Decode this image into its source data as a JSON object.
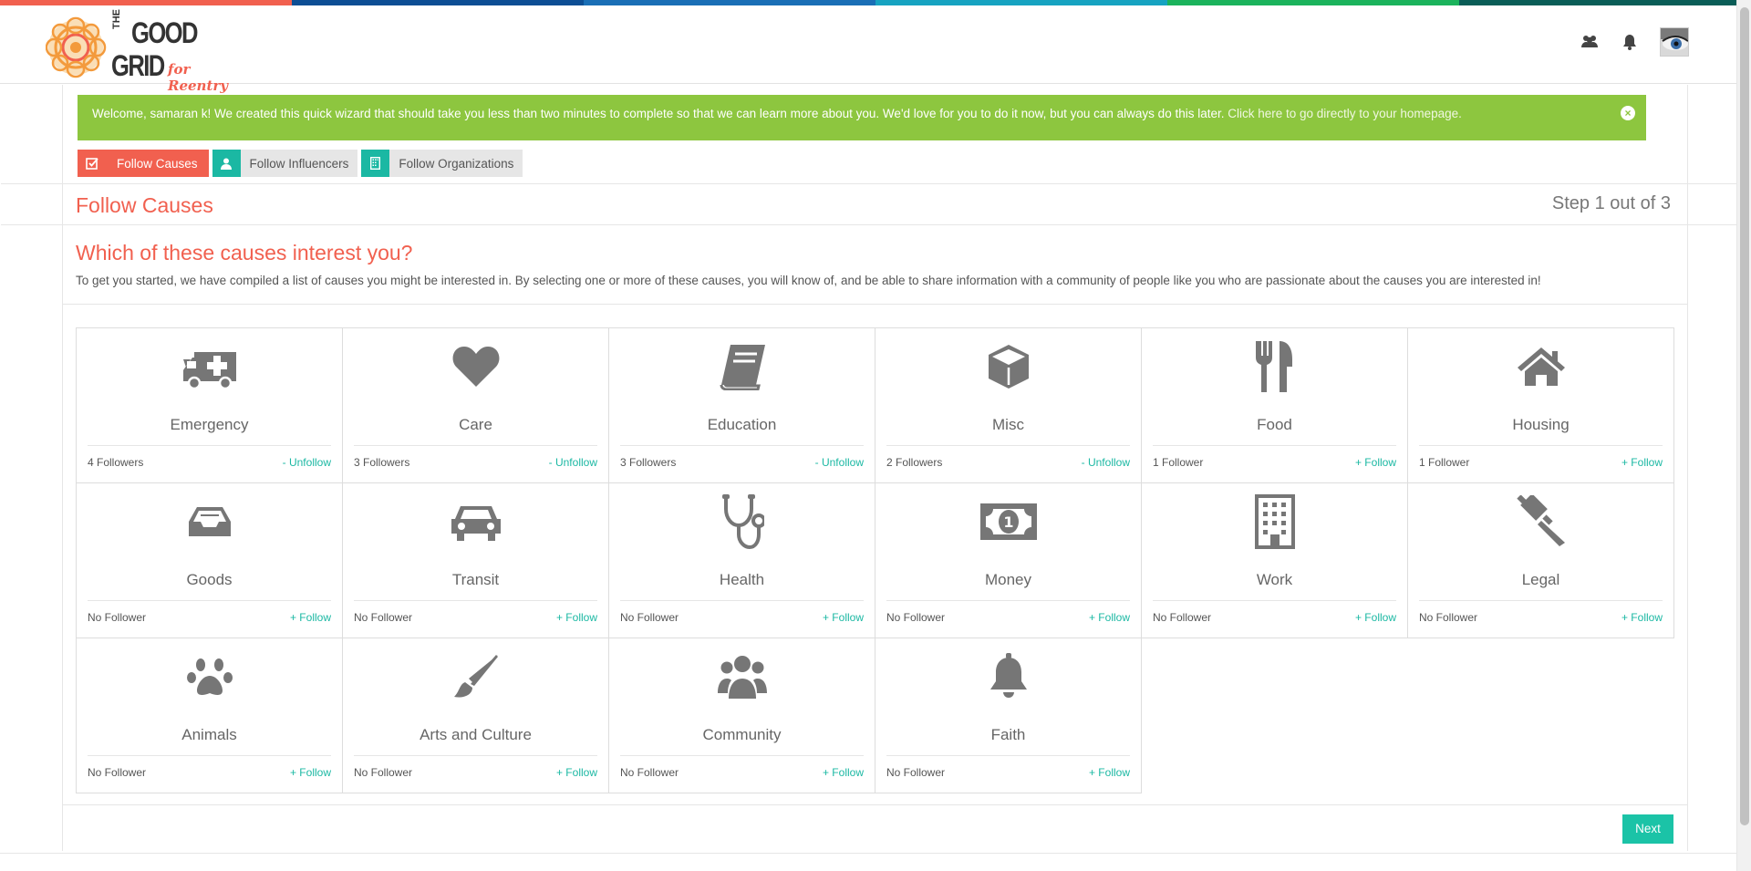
{
  "colors": {
    "top_strip": [
      "#f1604f",
      "#0d4e94",
      "#1a6fb6",
      "#16a3c1",
      "#1bb35c",
      "#0a5d57"
    ],
    "accent_red": "#f1604f",
    "accent_teal": "#1bb8a3",
    "welcome_green": "#8dc63f"
  },
  "logo": {
    "line1": "THE",
    "line2": "GOOD",
    "line3": "GRID",
    "tagline": "for Reentry"
  },
  "header": {
    "icons": [
      "users-icon",
      "bell-icon",
      "avatar"
    ]
  },
  "welcome": {
    "message": "Welcome, samaran k! We created this quick wizard that should take you less than two minutes to complete so that we can learn more about you. We'd love for you to do it now, but you can always do this later.",
    "link": "Click here to go directly to your homepage."
  },
  "steps": [
    {
      "label": "Follow Causes",
      "icon": "check-square-icon",
      "active": true
    },
    {
      "label": "Follow Influencers",
      "icon": "user-icon",
      "active": false
    },
    {
      "label": "Follow Organizations",
      "icon": "building-icon",
      "active": false
    }
  ],
  "section": {
    "title": "Follow Causes",
    "step_text": "Step 1 out of 3"
  },
  "question": {
    "title": "Which of these causes interest you?",
    "description": "To get you started, we have compiled a list of causes you might be interested in. By selecting one or more of these causes, you will know of, and be able to share information with a community of people like you who are passionate about the causes you are interested in!"
  },
  "causes": [
    {
      "name": "Emergency",
      "icon": "ambulance-icon",
      "followers": "4 Followers",
      "action": "- Unfollow"
    },
    {
      "name": "Care",
      "icon": "heart-icon",
      "followers": "3 Followers",
      "action": "- Unfollow"
    },
    {
      "name": "Education",
      "icon": "book-icon",
      "followers": "3 Followers",
      "action": "- Unfollow"
    },
    {
      "name": "Misc",
      "icon": "cube-icon",
      "followers": "2 Followers",
      "action": "- Unfollow"
    },
    {
      "name": "Food",
      "icon": "cutlery-icon",
      "followers": "1 Follower",
      "action": "+ Follow"
    },
    {
      "name": "Housing",
      "icon": "home-icon",
      "followers": "1 Follower",
      "action": "+ Follow"
    },
    {
      "name": "Goods",
      "icon": "inbox-icon",
      "followers": "No Follower",
      "action": "+ Follow"
    },
    {
      "name": "Transit",
      "icon": "car-icon",
      "followers": "No Follower",
      "action": "+ Follow"
    },
    {
      "name": "Health",
      "icon": "stethoscope-icon",
      "followers": "No Follower",
      "action": "+ Follow"
    },
    {
      "name": "Money",
      "icon": "money-icon",
      "followers": "No Follower",
      "action": "+ Follow"
    },
    {
      "name": "Work",
      "icon": "building-icon",
      "followers": "No Follower",
      "action": "+ Follow"
    },
    {
      "name": "Legal",
      "icon": "gavel-icon",
      "followers": "No Follower",
      "action": "+ Follow"
    },
    {
      "name": "Animals",
      "icon": "paw-icon",
      "followers": "No Follower",
      "action": "+ Follow"
    },
    {
      "name": "Arts and Culture",
      "icon": "paintbrush-icon",
      "followers": "No Follower",
      "action": "+ Follow"
    },
    {
      "name": "Community",
      "icon": "community-icon",
      "followers": "No Follower",
      "action": "+ Follow"
    },
    {
      "name": "Faith",
      "icon": "bell-icon",
      "followers": "No Follower",
      "action": "+ Follow"
    }
  ],
  "next_button": "Next"
}
